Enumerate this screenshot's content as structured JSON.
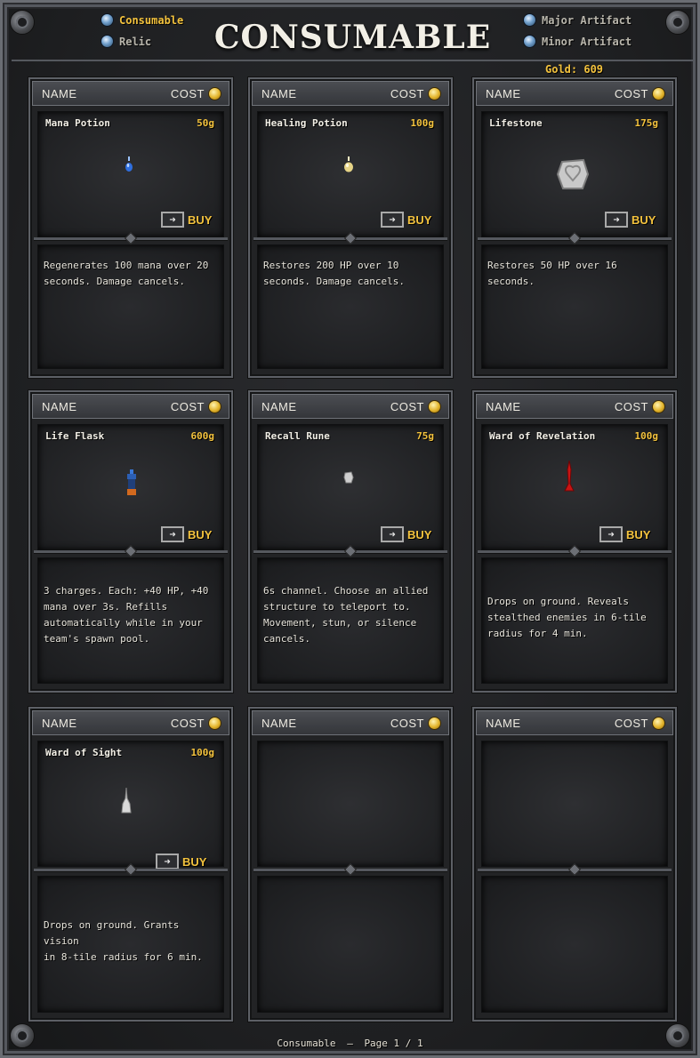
{
  "header": {
    "title": "CONSUMABLE",
    "tabs_left": [
      {
        "label": "Consumable",
        "active": true
      },
      {
        "label": "Relic",
        "active": false
      }
    ],
    "tabs_right": [
      {
        "label": "Major Artifact",
        "active": false
      },
      {
        "label": "Minor Artifact",
        "active": false
      }
    ],
    "gold": "Gold: 609"
  },
  "card_header": {
    "name_label": "NAME",
    "cost_label": "COST"
  },
  "buy_label": "BUY",
  "items": [
    {
      "name": "Mana Potion",
      "price": "50g",
      "icon": "mana-potion-icon",
      "desc": [
        "Regenerates 100 mana over 20",
        "seconds. Damage cancels."
      ]
    },
    {
      "name": "Healing Potion",
      "price": "100g",
      "icon": "healing-potion-icon",
      "desc": [
        "Restores 200 HP over 10",
        "seconds. Damage cancels."
      ]
    },
    {
      "name": "Lifestone",
      "price": "175g",
      "icon": "lifestone-icon",
      "desc": [
        "Restores 50 HP over 16",
        "seconds."
      ]
    },
    {
      "name": "Life Flask",
      "price": "600g",
      "icon": "life-flask-icon",
      "desc": [
        "3 charges. Each: +40 HP, +40",
        "mana over 3s. Refills",
        "automatically while in your",
        "team's spawn pool."
      ]
    },
    {
      "name": "Recall Rune",
      "price": "75g",
      "icon": "recall-rune-icon",
      "desc": [
        "6s channel. Choose an allied",
        "structure to teleport to.",
        "Movement, stun, or silence",
        "cancels."
      ]
    },
    {
      "name": "Ward of Revelation",
      "price": "100g",
      "icon": "ward-of-revelation-icon",
      "desc": [
        "Drops on ground. Reveals",
        "stealthed enemies in 6-tile",
        "radius for 4 min."
      ]
    },
    {
      "name": "Ward of Sight",
      "price": "100g",
      "icon": "ward-of-sight-icon",
      "desc": [
        "Drops on ground. Grants vision",
        "in 8-tile radius for 6 min."
      ]
    }
  ],
  "footer": {
    "category": "Consumable",
    "separator": "—",
    "page": "Page 1 / 1"
  },
  "colors": {
    "accent_gold": "#f3c23d",
    "text": "#e6e2d6",
    "frame": "#5d6066"
  }
}
